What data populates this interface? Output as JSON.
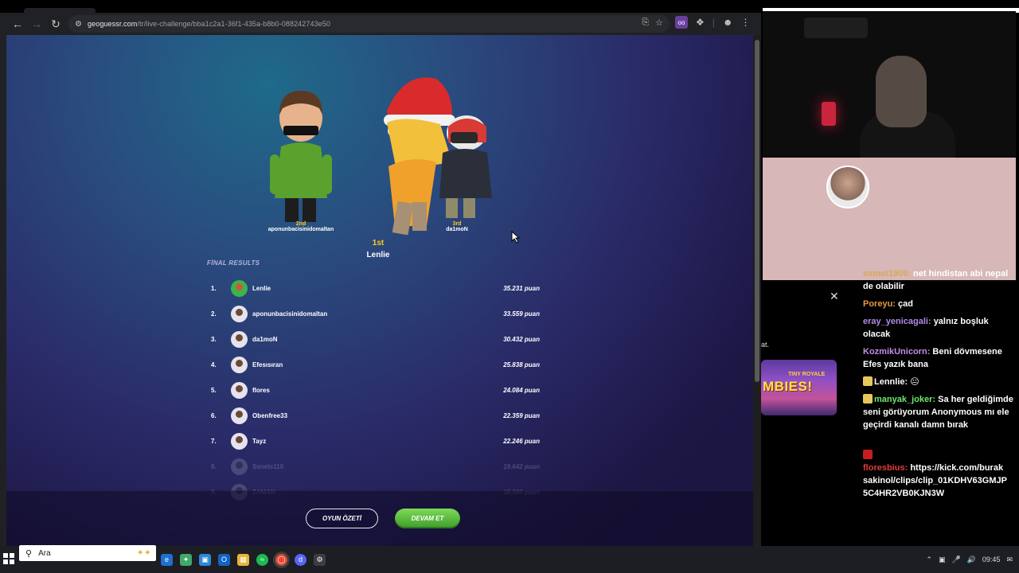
{
  "browser": {
    "url_host": "geoguessr.com",
    "url_path": "/tr/live-challenge/bba1c2a1-36f1-435a-b8b0-088242743e50",
    "ext_label": "oo"
  },
  "podium": {
    "second": {
      "place": "2nd",
      "name": "aponunbacisinidomaltan"
    },
    "first": {
      "place": "1st",
      "name": "Lenlie"
    },
    "third": {
      "place": "3rd",
      "name": "da1moN"
    }
  },
  "results": {
    "title": "FİNAL RESULTS",
    "rows": [
      {
        "rank": "1.",
        "name": "Lenlie",
        "score": "35.231 puan"
      },
      {
        "rank": "2.",
        "name": "aponunbacisinidomaltan",
        "score": "33.559 puan"
      },
      {
        "rank": "3.",
        "name": "da1moN",
        "score": "30.432 puan"
      },
      {
        "rank": "4.",
        "name": "Efesısıran",
        "score": "25.838 puan"
      },
      {
        "rank": "5.",
        "name": "flores",
        "score": "24.084 puan"
      },
      {
        "rank": "6.",
        "name": "Obenfree33",
        "score": "22.359 puan"
      },
      {
        "rank": "7.",
        "name": "Tayz",
        "score": "22.246 puan"
      },
      {
        "rank": "8.",
        "name": "Senets110",
        "score": "19.642 puan"
      },
      {
        "rank": "9.",
        "name": "ZAMAN",
        "score": "18.990 puan"
      }
    ]
  },
  "buttons": {
    "summary": "OYUN ÖZETİ",
    "continue": "DEVAM ET"
  },
  "chat": {
    "side_text": "at.",
    "promo_top": "TINY ROYALE",
    "promo_main": "MBIES!",
    "messages": [
      {
        "user": "samet1909",
        "user_color": "#d6a95b",
        "text": "net hindistan abi nepal de olabilir"
      },
      {
        "user": "Poreyu",
        "user_color": "#e89a3c",
        "text": "çad"
      },
      {
        "user": "eray_yenicagali",
        "user_color": "#b18ae6",
        "text": "yalnız boşluk olacak"
      },
      {
        "user": "KozmikUnicorn",
        "user_color": "#c58ee6",
        "text": "Beni dövmesene Efes yazık bana"
      },
      {
        "user": "Lennlie",
        "user_color": "#ffffff",
        "text": "😐"
      },
      {
        "user": "manyak_joker",
        "user_color": "#6ee86e",
        "text": "Sa her geldiğimde seni görüyorum Anonymous mı ele geçirdi kanalı damn bırak"
      },
      {
        "user": "floresbius",
        "user_color": "#e03b3b",
        "text": "https://kick.com/burak sakinol/clips/clip_01KDHV63GMJP 5C4HR2VB0KJN3W"
      }
    ]
  },
  "taskbar": {
    "search_placeholder": "Ara",
    "time": "09:45"
  }
}
